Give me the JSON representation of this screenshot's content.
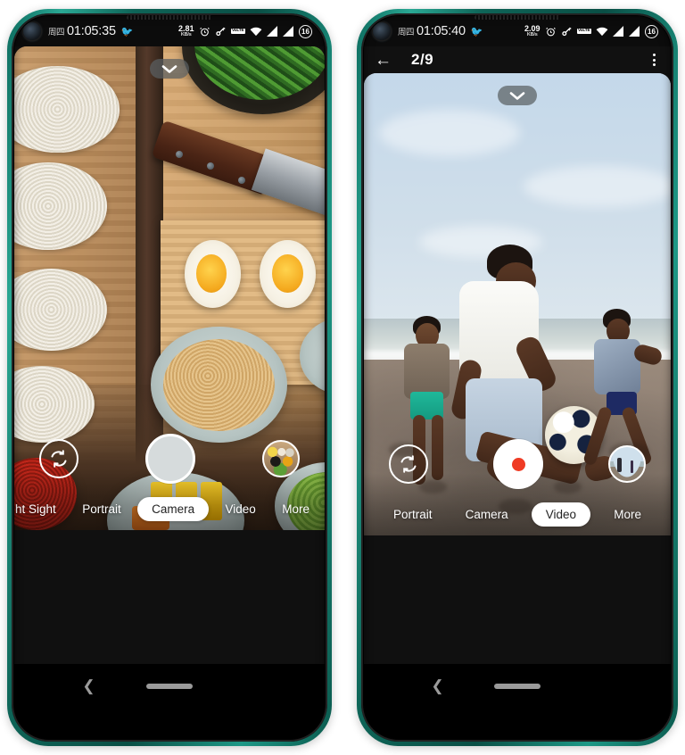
{
  "left_phone": {
    "status_bar": {
      "day_of_week": "周四",
      "time": "01:05:35",
      "bird_icon": "bird-icon",
      "net_speed_value": "2.81",
      "net_speed_unit": "KB/s",
      "alarm_icon": "alarm-clock-icon",
      "key_icon": "key-icon",
      "volte_label": "VoLTE",
      "wifi_icon": "wifi-icon",
      "signal_1_icon": "signal-bars-icon",
      "signal_2_icon": "signal-bars-icon",
      "battery_level": "16"
    },
    "camera": {
      "chevron_icon": "chevron-down-icon",
      "flip_icon": "camera-flip-icon",
      "shutter_label": "shutter-button",
      "thumbnail_label": "gallery-thumbnail",
      "modes": [
        {
          "label": "ht Sight",
          "active": false,
          "clipped": true
        },
        {
          "label": "Portrait",
          "active": false,
          "clipped": false
        },
        {
          "label": "Camera",
          "active": true,
          "clipped": false
        },
        {
          "label": "Video",
          "active": false,
          "clipped": false
        },
        {
          "label": "More",
          "active": false,
          "clipped": false
        }
      ]
    },
    "nav": {
      "back_icon": "nav-back-icon",
      "home_icon": "nav-home-indicator"
    }
  },
  "right_phone": {
    "status_bar": {
      "day_of_week": "周四",
      "time": "01:05:40",
      "bird_icon": "bird-icon",
      "net_speed_value": "2.09",
      "net_speed_unit": "KB/s",
      "alarm_icon": "alarm-clock-icon",
      "key_icon": "key-icon",
      "volte_label": "VoLTE",
      "wifi_icon": "wifi-icon",
      "signal_1_icon": "signal-bars-icon",
      "signal_2_icon": "signal-bars-icon",
      "battery_level": "16"
    },
    "header": {
      "back_icon": "back-arrow-icon",
      "title": "2/9",
      "menu_icon": "overflow-menu-icon"
    },
    "camera": {
      "chevron_icon": "chevron-down-icon",
      "flip_icon": "camera-flip-icon",
      "shutter_label": "record-button",
      "record_dot": "record-dot",
      "thumbnail_label": "gallery-thumbnail",
      "modes": [
        {
          "label": "Portrait",
          "active": false,
          "clipped": false
        },
        {
          "label": "Camera",
          "active": false,
          "clipped": false
        },
        {
          "label": "Video",
          "active": true,
          "clipped": false
        },
        {
          "label": "More",
          "active": false,
          "clipped": false
        }
      ]
    },
    "nav": {
      "back_icon": "nav-back-icon",
      "home_icon": "nav-home-indicator"
    }
  },
  "colors": {
    "frame": "#0f6b5c",
    "record_red": "#ef3b24",
    "active_pill": "#ffffff",
    "status_text": "#f2f2f2"
  }
}
